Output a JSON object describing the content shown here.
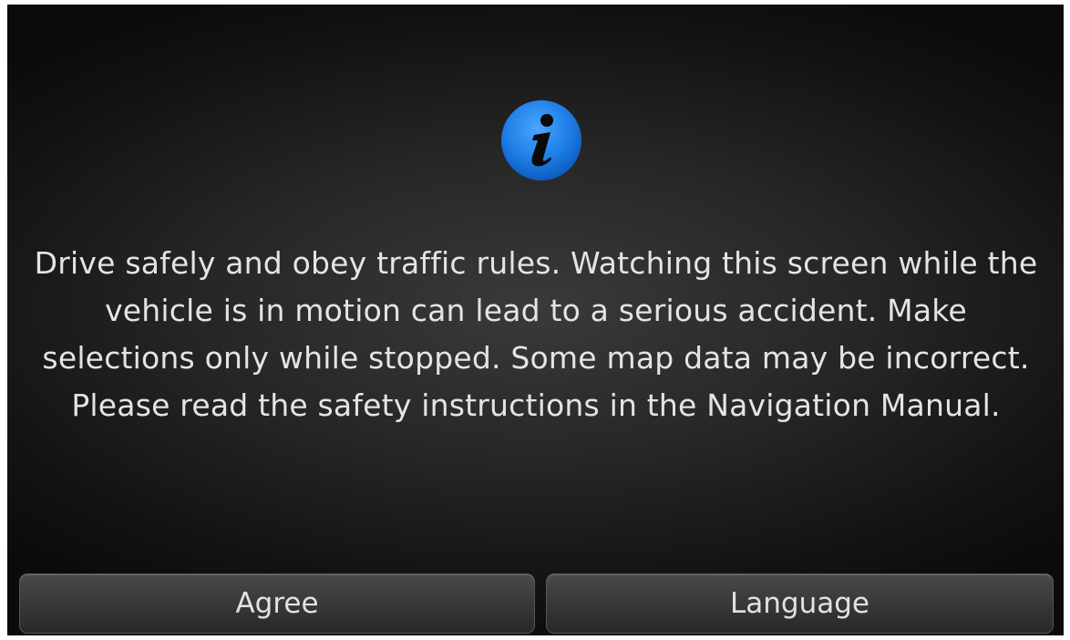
{
  "dialog": {
    "icon": "info-icon",
    "message": "Drive safely and obey traffic rules. Watching this screen while the vehicle is in motion can lead to a serious accident. Make selections only while stopped. Some map data may be incorrect. Please read the safety instructions in the Navigation Manual."
  },
  "buttons": {
    "agree_label": "Agree",
    "language_label": "Language"
  },
  "colors": {
    "icon_blue": "#1f7fe6",
    "background": "#1a1a1a",
    "text": "#e4e4e4"
  }
}
